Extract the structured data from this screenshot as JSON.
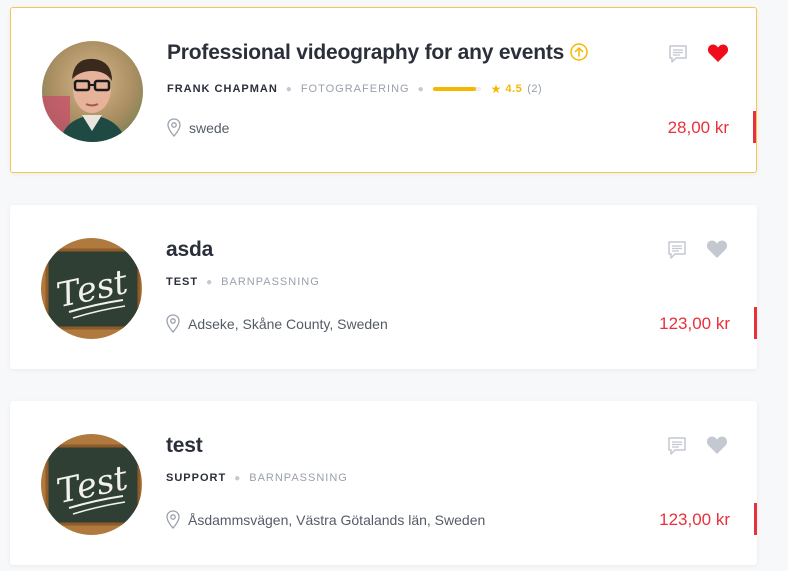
{
  "listings": [
    {
      "title": "Professional videography for any events",
      "boosted": true,
      "author": "FRANK CHAPMAN",
      "category": "FOTOGRAFERING",
      "rating": "4.5",
      "rating_fraction": 0.9,
      "reviews": "(2)",
      "location": "swede",
      "price": "28,00 kr",
      "favorited": true,
      "avatar": "person-photo"
    },
    {
      "title": "asda",
      "boosted": false,
      "author": "TEST",
      "category": "BARNPASSNING",
      "location": "Adseke, Skåne County, Sweden",
      "price": "123,00 kr",
      "favorited": false,
      "avatar": "chalkboard-test"
    },
    {
      "title": "test",
      "boosted": false,
      "author": "SUPPORT",
      "category": "BARNPASSNING",
      "location": "Åsdammsvägen, Västra Götalands län, Sweden",
      "price": "123,00 kr",
      "favorited": false,
      "avatar": "chalkboard-test"
    }
  ],
  "chalkboard_text": "Test",
  "colors": {
    "accent_red": "#e8313a",
    "gold": "#f5b800",
    "featured_border": "#f2c94c",
    "icon_gray": "#c4c8d0"
  }
}
